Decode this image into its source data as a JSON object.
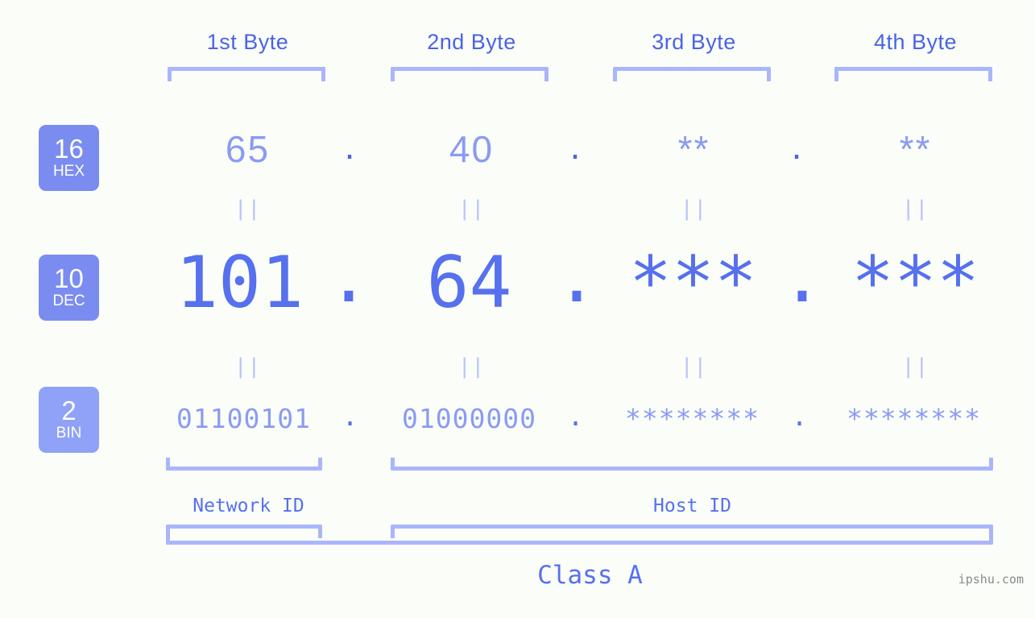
{
  "meta": {
    "background_color": "#fbfdf9",
    "accent_strong": "#4a63e8",
    "accent_mid": "#5670ee",
    "accent_light": "#8b9bf2",
    "accent_bracket": "#aab6fb",
    "badge_color": "#7b8cf0",
    "badge_color_bin": "#8fa2f7",
    "watermark_color": "#8a8a8a"
  },
  "byte_headers": [
    {
      "label": "1st Byte"
    },
    {
      "label": "2nd Byte"
    },
    {
      "label": "3rd Byte"
    },
    {
      "label": "4th Byte"
    }
  ],
  "radix_badges": [
    {
      "number": "16",
      "name": "HEX"
    },
    {
      "number": "10",
      "name": "DEC"
    },
    {
      "number": "2",
      "name": "BIN"
    }
  ],
  "rows": {
    "hex": {
      "values": [
        "65",
        "40",
        "**",
        "**"
      ],
      "separators": [
        ".",
        ".",
        "."
      ]
    },
    "dec": {
      "values": [
        "101",
        "64",
        "***",
        "***"
      ],
      "separators": [
        ".",
        ".",
        "."
      ]
    },
    "bin": {
      "values": [
        "01100101",
        "01000000",
        "********",
        "********"
      ],
      "separators": [
        ".",
        ".",
        "."
      ]
    }
  },
  "connectors": {
    "equals": "||",
    "hex_to_dec": [
      "||",
      "||",
      "||",
      "||"
    ],
    "dec_to_bin": [
      "||",
      "||",
      "||",
      "||"
    ]
  },
  "id_sections": [
    {
      "label": "Network ID"
    },
    {
      "label": "Host ID"
    }
  ],
  "class_section": {
    "label": "Class A"
  },
  "watermark": {
    "text": "ipshu.com"
  }
}
